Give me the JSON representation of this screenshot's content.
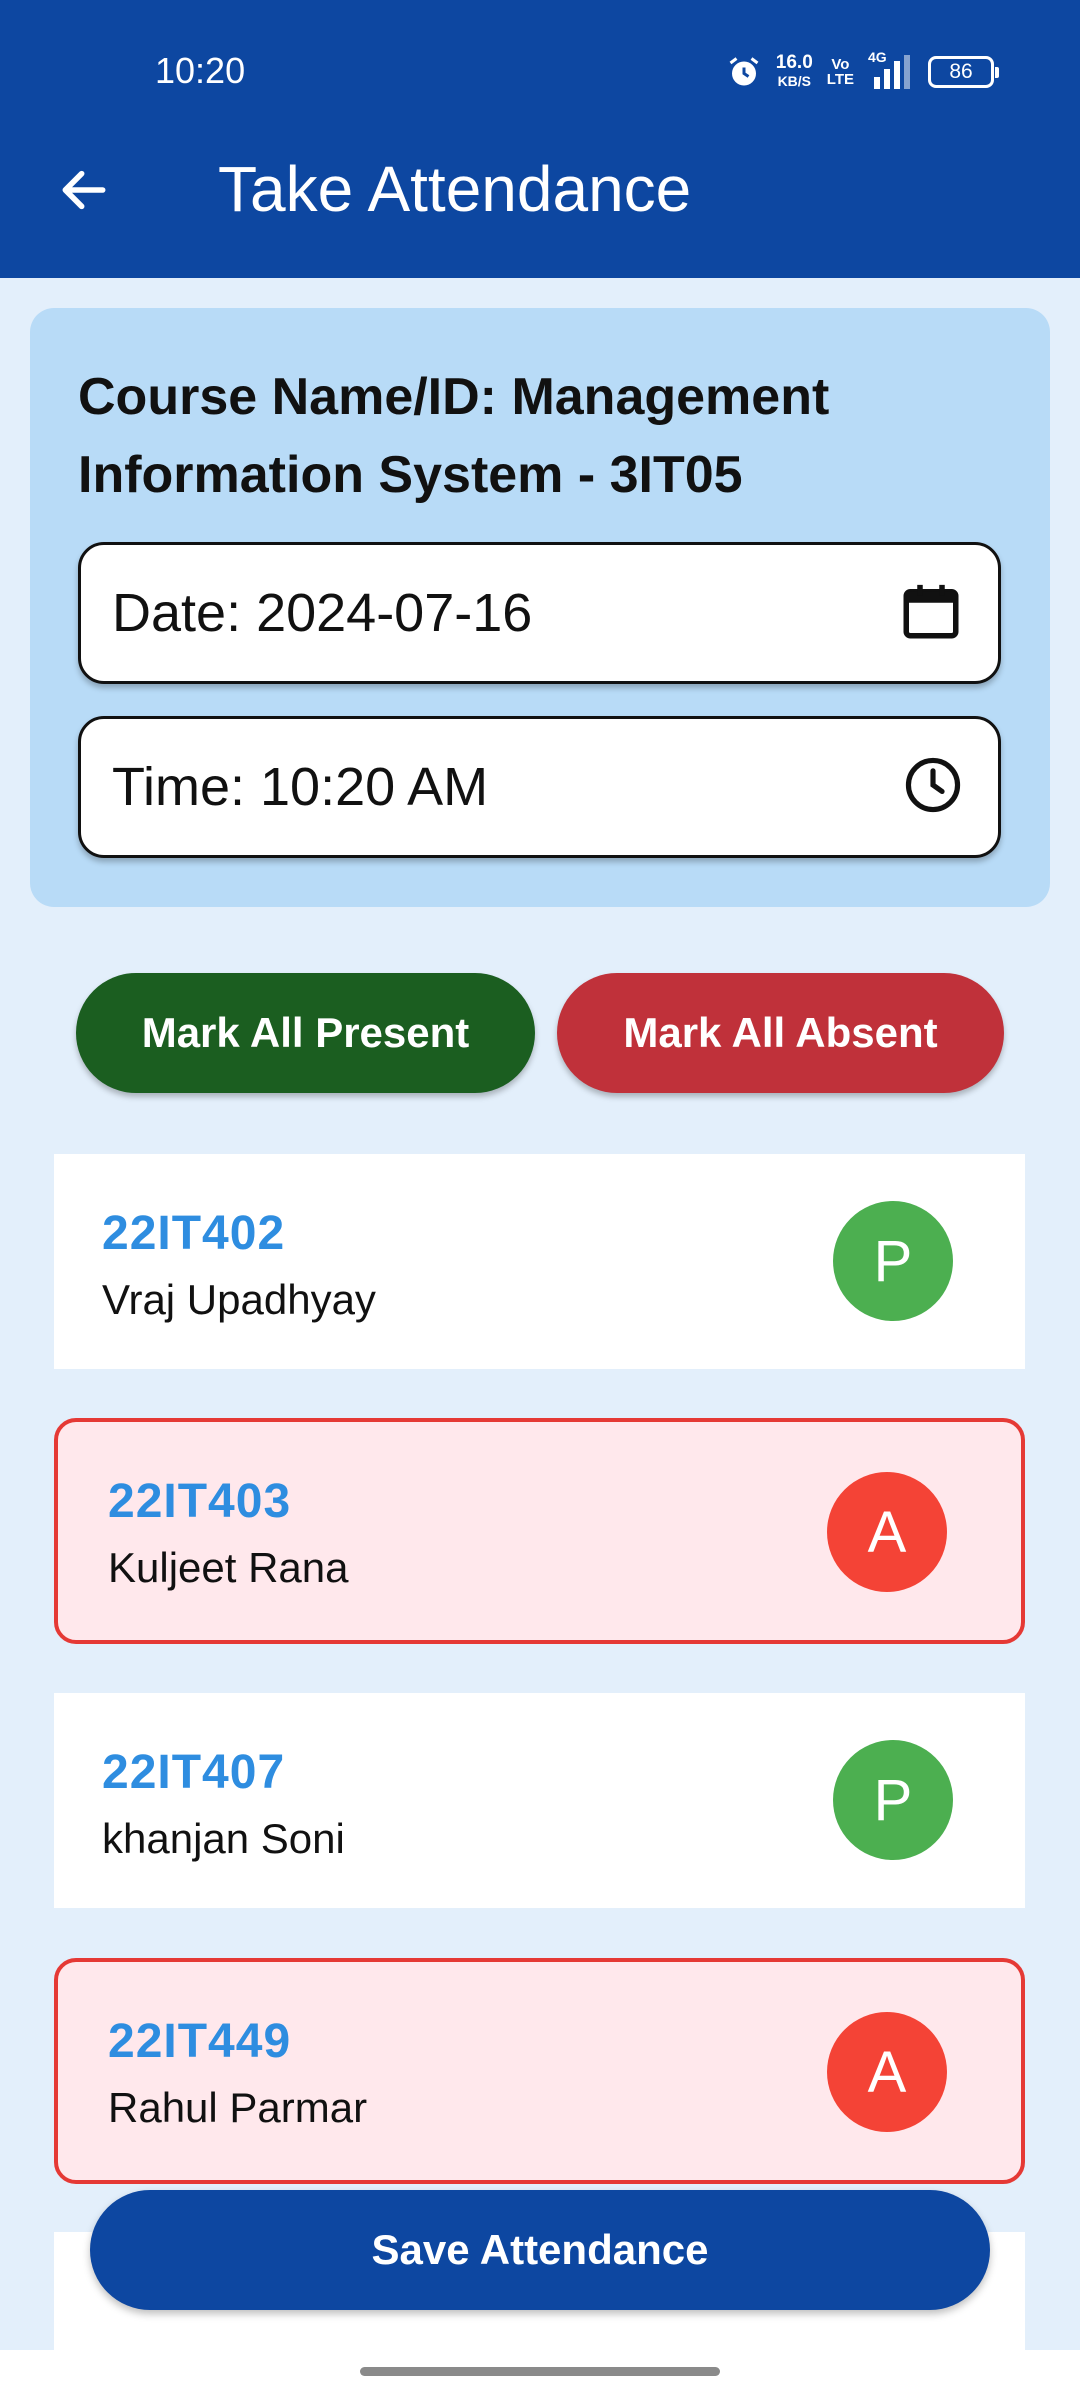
{
  "status_bar": {
    "time": "10:20",
    "speed_value": "16.0",
    "speed_unit": "KB/S",
    "volte_top": "Vo",
    "volte_bottom": "LTE",
    "network": "4G",
    "battery": "86"
  },
  "header": {
    "title": "Take Attendance"
  },
  "course": {
    "label": "Course Name/ID: Management Information System  - 3IT05",
    "date_label": "Date: 2024-07-16",
    "time_label": "Time: 10:20 AM"
  },
  "actions": {
    "mark_all_present": "Mark All Present",
    "mark_all_absent": "Mark All Absent",
    "save": "Save Attendance"
  },
  "students": [
    {
      "id": "22IT402",
      "name": "Vraj Upadhyay",
      "status": "P"
    },
    {
      "id": "22IT403",
      "name": "Kuljeet Rana",
      "status": "A"
    },
    {
      "id": "22IT407",
      "name": "khanjan Soni",
      "status": "P"
    },
    {
      "id": "22IT449",
      "name": "Rahul Parmar",
      "status": "A"
    }
  ],
  "colors": {
    "app_bar": "#0d47a1",
    "present": "#4caf50",
    "absent": "#f44336",
    "id_text": "#2e8de0"
  },
  "icons": [
    "back-arrow-icon",
    "calendar-icon",
    "clock-icon",
    "alarm-icon",
    "signal-icon"
  ]
}
